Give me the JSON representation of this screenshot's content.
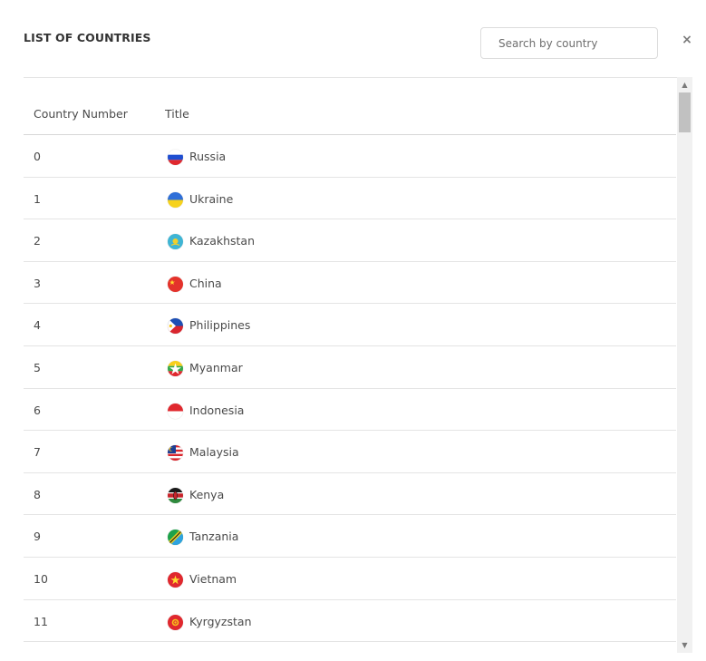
{
  "dialog": {
    "title": "LIST OF COUNTRIES",
    "search_placeholder": "Search by country",
    "close_glyph": "×"
  },
  "table": {
    "headers": {
      "number": "Country Number",
      "title": "Title"
    },
    "rows": [
      {
        "number": "0",
        "name": "Russia",
        "flag": "russia-flag-icon"
      },
      {
        "number": "1",
        "name": "Ukraine",
        "flag": "ukraine-flag-icon"
      },
      {
        "number": "2",
        "name": "Kazakhstan",
        "flag": "kazakhstan-flag-icon"
      },
      {
        "number": "3",
        "name": "China",
        "flag": "china-flag-icon"
      },
      {
        "number": "4",
        "name": "Philippines",
        "flag": "philippines-flag-icon"
      },
      {
        "number": "5",
        "name": "Myanmar",
        "flag": "myanmar-flag-icon"
      },
      {
        "number": "6",
        "name": "Indonesia",
        "flag": "indonesia-flag-icon"
      },
      {
        "number": "7",
        "name": "Malaysia",
        "flag": "malaysia-flag-icon"
      },
      {
        "number": "8",
        "name": "Kenya",
        "flag": "kenya-flag-icon"
      },
      {
        "number": "9",
        "name": "Tanzania",
        "flag": "tanzania-flag-icon"
      },
      {
        "number": "10",
        "name": "Vietnam",
        "flag": "vietnam-flag-icon"
      },
      {
        "number": "11",
        "name": "Kyrgyzstan",
        "flag": "kyrgyzstan-flag-icon"
      }
    ]
  },
  "scrollbar": {
    "up_glyph": "▲",
    "down_glyph": "▼",
    "position": 0.0
  }
}
